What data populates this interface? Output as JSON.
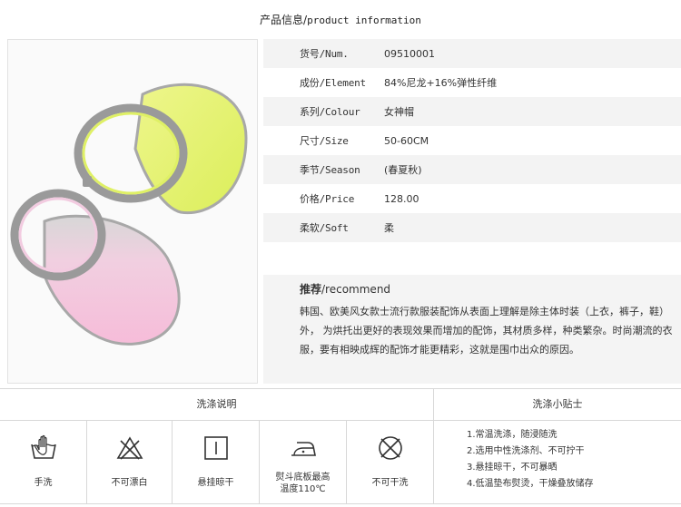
{
  "header": {
    "title_cn": "产品信息/",
    "title_en": "product information"
  },
  "image": {
    "subject": "sun-visor-hats",
    "colors": {
      "yellow": "#e8f27a",
      "pink": "#f3c6dc",
      "rim": "#a9a9a9"
    }
  },
  "specs": [
    {
      "key": "货号/Num.",
      "value": "09510001"
    },
    {
      "key": "成份/Element",
      "value": "84%尼龙+16%弹性纤维"
    },
    {
      "key": "系列/Colour",
      "value": "女神帽"
    },
    {
      "key": "尺寸/Size",
      "value": "50-60CM"
    },
    {
      "key": "季节/Season",
      "value": "(春夏秋)"
    },
    {
      "key": "价格/Price",
      "value": "128.00"
    },
    {
      "key": "柔软/Soft",
      "value": "柔"
    }
  ],
  "recommend": {
    "title_bold": "推荐",
    "title_rest": "/recommend",
    "text": "韩国、欧美风女款士流行款服装配饰从表面上理解是除主体时装（上衣，裤子，鞋）外， 为烘托出更好的表现效果而增加的配饰，其材质多样，种类繁杂。时尚潮流的衣服，要有相映成辉的配饰才能更精彩，这就是围巾出众的原因。"
  },
  "care": {
    "instructions_title": "洗涤说明",
    "tips_title": "洗涤小贴士",
    "icons": [
      {
        "icon": "hand-wash-icon",
        "label": "手洗"
      },
      {
        "icon": "no-bleach-icon",
        "label": "不可漂白"
      },
      {
        "icon": "line-dry-icon",
        "label": "悬挂晾干"
      },
      {
        "icon": "iron-icon",
        "label": "熨斗底板最高",
        "label2": "温度110℃"
      },
      {
        "icon": "no-dry-clean-icon",
        "label": "不可干洗"
      }
    ],
    "tips": [
      "1.常温洗涤，随浸随洗",
      "2.选用中性洗涤剂、不可拧干",
      "3.悬挂晾干，不可暴晒",
      "4.低温垫布熨烫，干燥叠放储存"
    ]
  }
}
